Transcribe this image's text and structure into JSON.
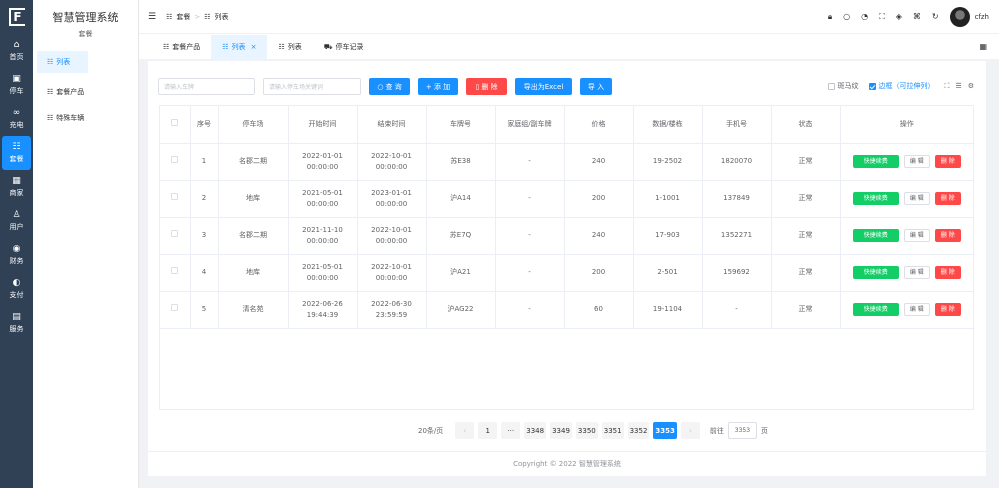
{
  "logo": "F",
  "rail": [
    {
      "icon": "home-icon",
      "glyph": "⌂",
      "label": "首页",
      "active": false
    },
    {
      "icon": "parking-icon",
      "glyph": "▣",
      "label": "停车",
      "active": false
    },
    {
      "icon": "charge-icon",
      "glyph": "∞",
      "label": "充电",
      "active": false
    },
    {
      "icon": "package-icon",
      "glyph": "☷",
      "label": "套餐",
      "active": true
    },
    {
      "icon": "merchant-icon",
      "glyph": "▦",
      "label": "商家",
      "active": false
    },
    {
      "icon": "user-icon",
      "glyph": "♙",
      "label": "用户",
      "active": false
    },
    {
      "icon": "finance-icon",
      "glyph": "◉",
      "label": "财务",
      "active": false
    },
    {
      "icon": "pay-icon",
      "glyph": "◐",
      "label": "支付",
      "active": false
    },
    {
      "icon": "service-icon",
      "glyph": "▤",
      "label": "服务",
      "active": false
    }
  ],
  "submenu": {
    "title": "智慧管理系统",
    "subtitle": "套餐",
    "items": [
      {
        "label": "列表",
        "active": true
      },
      {
        "label": "套餐产品",
        "active": false
      },
      {
        "label": "特殊车辆",
        "active": false
      }
    ]
  },
  "topbar": {
    "breadcrumb": [
      "套餐",
      "列表"
    ],
    "username": "cfzh"
  },
  "tabs": [
    {
      "label": "套餐产品",
      "active": false,
      "closable": false
    },
    {
      "label": "列表",
      "active": true,
      "closable": true
    },
    {
      "label": "列表",
      "active": false,
      "closable": false
    },
    {
      "label": "停车记录",
      "active": false,
      "closable": false
    }
  ],
  "toolbar": {
    "plate_placeholder": "请输入车牌",
    "lot_placeholder": "请输入停车场关键词",
    "search": "查 询",
    "add": "+ 添 加",
    "delete": "删 除",
    "export": "导出为Excel",
    "import": "导 入",
    "zebra": "斑马纹",
    "border": "边框（可拉伸列）"
  },
  "table": {
    "headers": [
      "",
      "序号",
      "停车场",
      "开始时间",
      "结束时间",
      "车牌号",
      "家庭组/副车牌",
      "价格",
      "数据/楼栋",
      "手机号",
      "状态",
      "操作"
    ],
    "rows": [
      {
        "no": "1",
        "lot": "名郡二期",
        "start": "2022-01-01 00:00:00",
        "end": "2022-10-01 00:00:00",
        "plate": "苏E38",
        "family": "-",
        "price": "240",
        "unit": "19-2502",
        "phone": "1820070",
        "status": "正常"
      },
      {
        "no": "2",
        "lot": "地库",
        "start": "2021-05-01 00:00:00",
        "end": "2023-01-01 00:00:00",
        "plate": "沪A14",
        "family": "-",
        "price": "200",
        "unit": "1-1001",
        "phone": "137849",
        "status": "正常"
      },
      {
        "no": "3",
        "lot": "名郡二期",
        "start": "2021-11-10 00:00:00",
        "end": "2022-10-01 00:00:00",
        "plate": "苏E7Q",
        "family": "-",
        "price": "240",
        "unit": "17-903",
        "phone": "1352271",
        "status": "正常"
      },
      {
        "no": "4",
        "lot": "地库",
        "start": "2021-05-01 00:00:00",
        "end": "2022-10-01 00:00:00",
        "plate": "沪A21",
        "family": "-",
        "price": "200",
        "unit": "2-501",
        "phone": "159692",
        "status": "正常"
      },
      {
        "no": "5",
        "lot": "清名苑",
        "start": "2022-06-26 19:44:39",
        "end": "2022-06-30 23:59:59",
        "plate": "沪AG22",
        "family": "-",
        "price": "60",
        "unit": "19-1104",
        "phone": "-",
        "status": "正常"
      }
    ],
    "action_renew": "快捷续费",
    "action_edit": "编 辑",
    "action_delete": "删 除"
  },
  "pagination": {
    "page_size": "20条/页",
    "pages": [
      "1",
      "···",
      "3348",
      "3349",
      "3350",
      "3351",
      "3352",
      "3353"
    ],
    "current": "3353",
    "goto_label": "前往",
    "goto_value": "3353",
    "page_unit": "页"
  },
  "footer": "Copyright © 2022 智慧管理系统"
}
